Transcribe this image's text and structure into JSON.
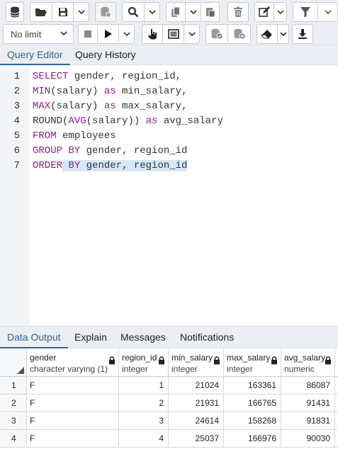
{
  "toolbar": {
    "limit_select": "No limit"
  },
  "editor_tabs": [
    "Query Editor",
    "Query History"
  ],
  "editor": {
    "line_numbers": [
      "1",
      "2",
      "3",
      "4",
      "5",
      "6",
      "7"
    ],
    "lines": [
      [
        {
          "t": "SELECT",
          "c": "kw"
        },
        {
          "t": " gender, region_id,",
          "c": "pl"
        }
      ],
      [
        {
          "t": "MIN",
          "c": "fn"
        },
        {
          "t": "(salary) ",
          "c": "pl"
        },
        {
          "t": "as",
          "c": "kw"
        },
        {
          "t": " min_salary,",
          "c": "pl"
        }
      ],
      [
        {
          "t": "MAX",
          "c": "fn"
        },
        {
          "t": "(salary) ",
          "c": "pl"
        },
        {
          "t": "as",
          "c": "kw"
        },
        {
          "t": " max_salary,",
          "c": "pl"
        }
      ],
      [
        {
          "t": "ROUND(",
          "c": "pl"
        },
        {
          "t": "AVG",
          "c": "fn"
        },
        {
          "t": "(salary)) ",
          "c": "pl"
        },
        {
          "t": "as",
          "c": "kw"
        },
        {
          "t": " avg_salary",
          "c": "pl"
        }
      ],
      [
        {
          "t": "FROM",
          "c": "kw"
        },
        {
          "t": " employees",
          "c": "pl"
        }
      ],
      [
        {
          "t": "GROUP BY",
          "c": "kw"
        },
        {
          "t": " gender, region_id",
          "c": "pl"
        }
      ],
      [
        {
          "t": "ORDER",
          "c": "kw"
        },
        {
          "t": " ",
          "c": "pl sel"
        },
        {
          "t": "BY",
          "c": "kw sel"
        },
        {
          "t": " gender, region_id",
          "c": "pl sel"
        }
      ]
    ]
  },
  "result_tabs": [
    "Data Output",
    "Explain",
    "Messages",
    "Notifications"
  ],
  "grid": {
    "columns": [
      {
        "name": "gender",
        "type": "character varying (1)"
      },
      {
        "name": "region_id",
        "type": "integer"
      },
      {
        "name": "min_salary",
        "type": "integer"
      },
      {
        "name": "max_salary",
        "type": "integer"
      },
      {
        "name": "avg_salary",
        "type": "numeric"
      }
    ],
    "rows": [
      {
        "n": "1",
        "cells": [
          "F",
          "1",
          "21024",
          "163361",
          "86087"
        ]
      },
      {
        "n": "2",
        "cells": [
          "F",
          "2",
          "21931",
          "166765",
          "91431"
        ]
      },
      {
        "n": "3",
        "cells": [
          "F",
          "3",
          "24614",
          "158268",
          "91831"
        ]
      },
      {
        "n": "4",
        "cells": [
          "F",
          "4",
          "25037",
          "166976",
          "90030"
        ]
      }
    ]
  }
}
